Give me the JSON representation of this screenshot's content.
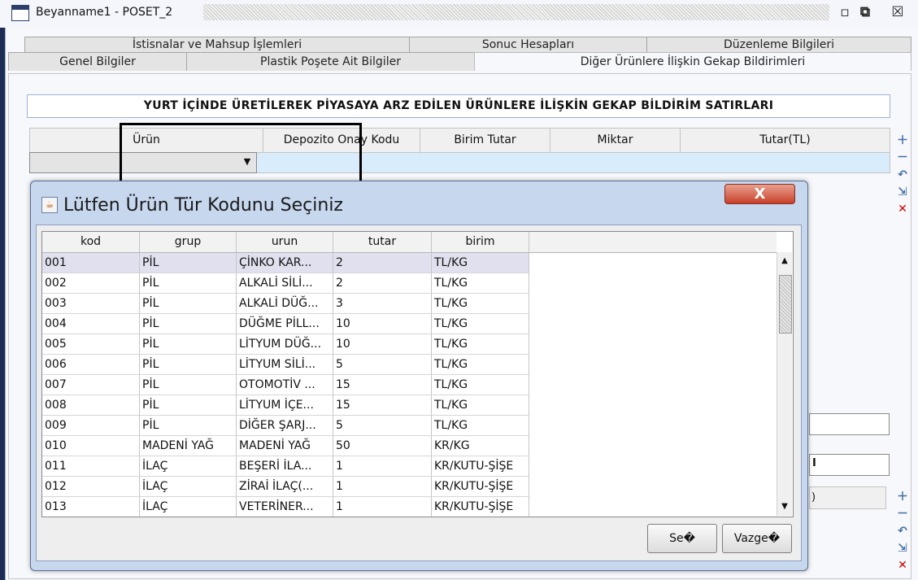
{
  "window": {
    "title": "Beyanname1 - POSET_2",
    "buttons": {
      "restore": "▫",
      "maximize": "⧉",
      "close": "☒"
    }
  },
  "tabs": {
    "row1": [
      "İstisnalar ve Mahsup İşlemleri",
      "Sonuc Hesapları",
      "Düzenleme Bilgileri"
    ],
    "row2": [
      "Genel Bilgiler",
      "Plastik Poşete Ait Bilgiler",
      "Diğer Ürünlere İlişkin Gekap Bildirimleri"
    ],
    "active": "Diğer Ürünlere İlişkin Gekap Bildirimleri"
  },
  "section": {
    "title": "YURT İÇİNDE ÜRETİLEREK PİYASAYA ARZ EDİLEN ÜRÜNLERE İLİŞKİN GEKAP BİLDİRİM SATIRLARI"
  },
  "main_table": {
    "headers": [
      "Ürün",
      "Depozito Onay Kodu",
      "Birim Tutar",
      "Miktar",
      "Tutar(TL)"
    ],
    "combo_value": ""
  },
  "side_icons": [
    "plus-icon",
    "minus-icon",
    "undo-icon",
    "export-icon",
    "delete-icon"
  ],
  "dialog": {
    "title": "Lütfen Ürün Tür Kodunu Seçiniz",
    "close_label": "X",
    "columns": [
      "kod",
      "grup",
      "urun",
      "tutar",
      "birim"
    ],
    "rows": [
      [
        "001",
        "PİL",
        "ÇİNKO KAR...",
        "2",
        "TL/KG"
      ],
      [
        "002",
        "PİL",
        "ALKALİ SİLİ...",
        "2",
        "TL/KG"
      ],
      [
        "003",
        "PİL",
        "ALKALİ DÜĞ...",
        "3",
        "TL/KG"
      ],
      [
        "004",
        "PİL",
        "DÜĞME PİLL...",
        "10",
        "TL/KG"
      ],
      [
        "005",
        "PİL",
        "LİTYUM DÜĞ...",
        "10",
        "TL/KG"
      ],
      [
        "006",
        "PİL",
        "LİTYUM SİLİ...",
        "5",
        "TL/KG"
      ],
      [
        "007",
        "PİL",
        "OTOMOTİV ...",
        "15",
        "TL/KG"
      ],
      [
        "008",
        "PİL",
        "LİTYUM İÇE...",
        "15",
        "TL/KG"
      ],
      [
        "009",
        "PİL",
        "DİĞER ŞARJ...",
        "5",
        "TL/KG"
      ],
      [
        "010",
        "MADENİ YAĞ",
        "MADENİ YAĞ",
        "50",
        "KR/KG"
      ],
      [
        "011",
        "İLAÇ",
        "BEŞERİ İLA...",
        "1",
        "KR/KUTU-ŞİŞE"
      ],
      [
        "012",
        "İLAÇ",
        "ZİRAİ İLAÇ(...",
        "1",
        "KR/KUTU-ŞİŞE"
      ],
      [
        "013",
        "İLAÇ",
        "VETERİNER...",
        "1",
        "KR/KUTU-ŞİŞE"
      ]
    ],
    "selected_row": 0,
    "buttons": {
      "select": "Se�",
      "cancel": "Vazge�"
    }
  },
  "background": {
    "partial_label": "I",
    "partial_header": ")"
  }
}
